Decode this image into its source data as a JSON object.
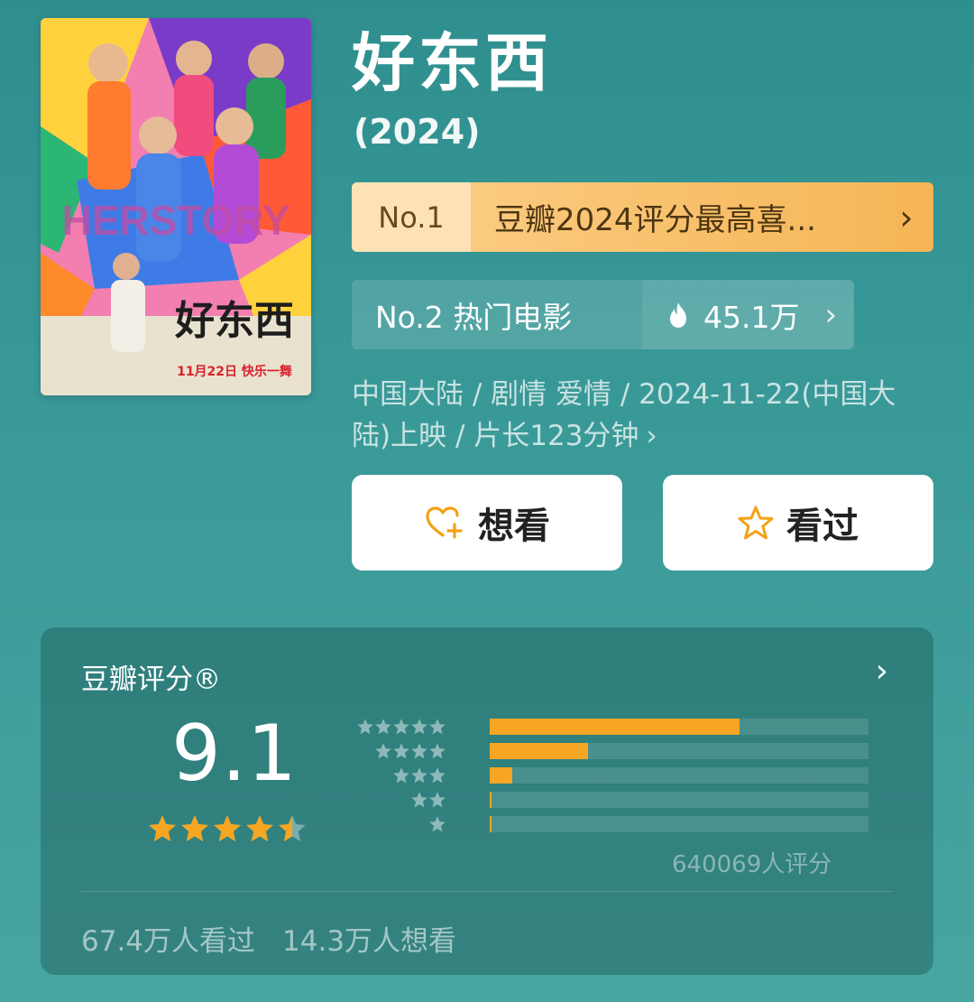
{
  "movie": {
    "title": "好东西",
    "year": "(2024)"
  },
  "poster": {
    "title_art": "好东西",
    "release_text": "11月22日 快乐一舞",
    "watermark": "HERSTORY"
  },
  "rank_primary": {
    "number": "No.1",
    "text": "豆瓣2024评分最高喜...",
    "chevron": "›"
  },
  "rank_secondary": {
    "label": "No.2 热门电影",
    "icon": "flame-icon",
    "count": "45.1万",
    "chevron": "›"
  },
  "meta": {
    "text": "中国大陆 / 剧情 爱情 / 2024-11-22(中国大陆)上映 / 片长123分钟",
    "chevron": "›"
  },
  "actions": {
    "want_label": "想看",
    "seen_label": "看过",
    "want_icon": "heart-plus-icon",
    "seen_icon": "star-icon"
  },
  "rating": {
    "heading": "豆瓣评分®",
    "chevron": "›",
    "score": "9.1",
    "star_value": 4.5,
    "distribution": [
      {
        "stars": 5,
        "percent": 66
      },
      {
        "stars": 4,
        "percent": 26
      },
      {
        "stars": 3,
        "percent": 6
      },
      {
        "stars": 2,
        "percent": 0.5
      },
      {
        "stars": 1,
        "percent": 0.5
      }
    ],
    "count_text": "640069人评分"
  },
  "stats": {
    "seen": "67.4万人看过",
    "want": "14.3万人想看"
  },
  "colors": {
    "background": "#3a9a98",
    "accent": "#f6a623",
    "rank_gold": "#f6b555"
  }
}
